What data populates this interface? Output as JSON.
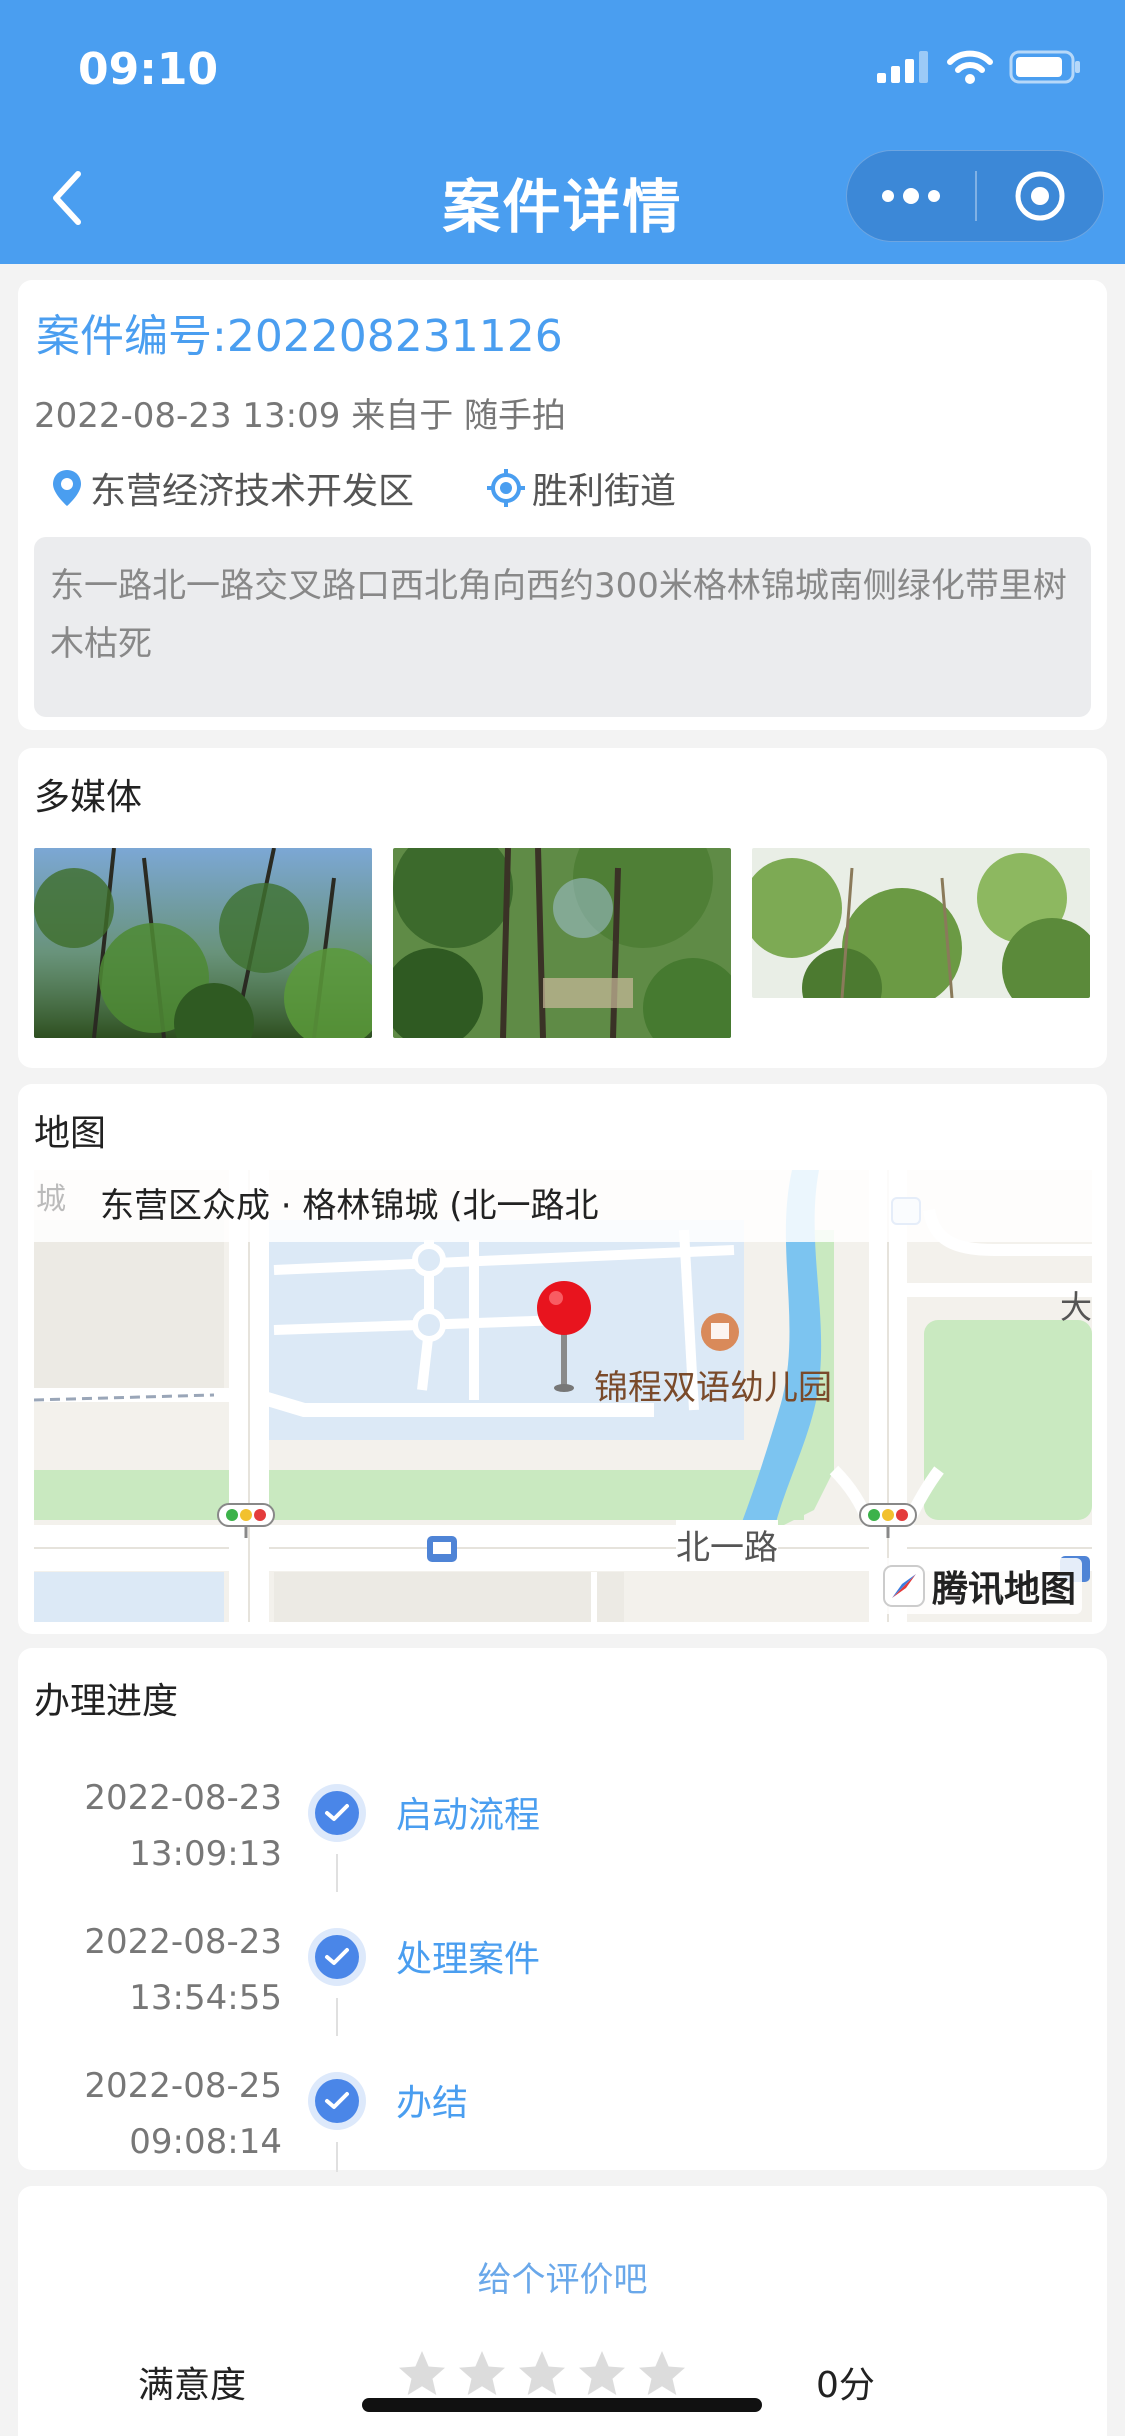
{
  "status_bar": {
    "time": "09:10"
  },
  "nav": {
    "title": "案件详情"
  },
  "case": {
    "number_label": "案件编号:202208231126",
    "meta": "2022-08-23 13:09 来自于 随手拍",
    "district": "东营经济技术开发区",
    "street": "胜利街道",
    "description": "东一路北一路交叉路口西北角向西约300米格林锦城南侧绿化带里树木枯死"
  },
  "media": {
    "title": "多媒体",
    "count": 3
  },
  "map": {
    "title": "地图",
    "address": "东营区众成 · 格林锦城 (北一路北",
    "poi": "锦程双语幼儿园",
    "road": "北一路",
    "edge_text_left": "城",
    "edge_text_right": "大",
    "brand": "腾讯地图"
  },
  "progress": {
    "title": "办理进度",
    "steps": [
      {
        "date": "2022-08-23",
        "time": "13:09:13",
        "label": "启动流程"
      },
      {
        "date": "2022-08-23",
        "time": "13:54:55",
        "label": "处理案件"
      },
      {
        "date": "2022-08-25",
        "time": "09:08:14",
        "label": "办结"
      }
    ]
  },
  "rating": {
    "prompt": "给个评价吧",
    "label": "满意度",
    "stars_total": 5,
    "stars_filled": 0,
    "score": "0分"
  },
  "colors": {
    "primary": "#4a9ef0",
    "check": "#4a86e8",
    "pin": "#e8141e"
  }
}
